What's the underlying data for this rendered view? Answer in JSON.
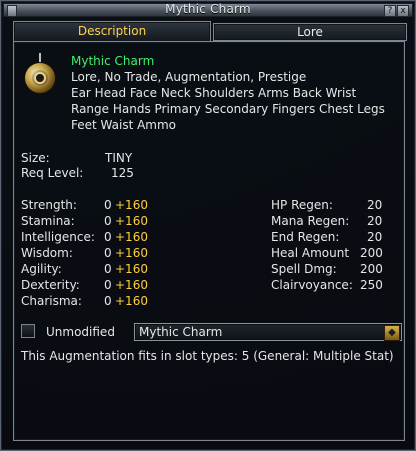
{
  "window": {
    "title": "Mythic Charm",
    "help_label": "?",
    "close_label": "x"
  },
  "tabs": [
    {
      "label": "Description",
      "active": true
    },
    {
      "label": "Lore",
      "active": false
    }
  ],
  "item": {
    "name": "Mythic Charm",
    "icon": "charm-icon",
    "flags": "Lore, No Trade, Augmentation, Prestige",
    "slots_line1": "Ear Head Face Neck Shoulders Arms Back Wrist",
    "slots_line2": "Range Hands Primary Secondary Fingers Chest Legs",
    "slots_line3": "Feet Waist Ammo"
  },
  "info": {
    "size_label": "Size:",
    "size_value": "TINY",
    "req_label": "Req Level:",
    "req_value": "125"
  },
  "stats_left": [
    {
      "label": "Strength:",
      "base": "0",
      "bonus": "+160"
    },
    {
      "label": "Stamina:",
      "base": "0",
      "bonus": "+160"
    },
    {
      "label": "Intelligence:",
      "base": "0",
      "bonus": "+160"
    },
    {
      "label": "Wisdom:",
      "base": "0",
      "bonus": "+160"
    },
    {
      "label": "Agility:",
      "base": "0",
      "bonus": "+160"
    },
    {
      "label": "Dexterity:",
      "base": "0",
      "bonus": "+160"
    },
    {
      "label": "Charisma:",
      "base": "0",
      "bonus": "+160"
    }
  ],
  "stats_right": [
    {
      "label": "HP Regen:",
      "value": "20"
    },
    {
      "label": "Mana Regen:",
      "value": "20"
    },
    {
      "label": "End Regen:",
      "value": "20"
    },
    {
      "label": "Heal Amount",
      "value": "200"
    },
    {
      "label": "Spell Dmg:",
      "value": "200"
    },
    {
      "label": "Clairvoyance:",
      "value": "250"
    }
  ],
  "augment": {
    "checkbox_label": "Unmodified",
    "checked": false,
    "dropdown_value": "Mythic Charm",
    "fits_text": "This Augmentation fits in slot types: 5 (General: Multiple Stat)"
  },
  "colors": {
    "accent_green": "#3ff06a",
    "accent_yellow": "#ffcf3a",
    "tab_active_text": "#ffd34d"
  }
}
